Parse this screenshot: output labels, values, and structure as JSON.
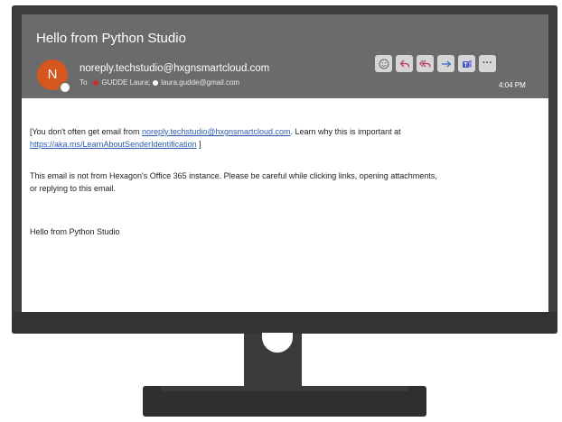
{
  "email": {
    "subject": "Hello from Python Studio",
    "avatar_initial": "N",
    "sender": "noreply.techstudio@hxgnsmartcloud.com",
    "to_label": "To",
    "recipient_1": "GUDDE Laura;",
    "recipient_2": "laura.gudde@gmail.com",
    "time": "4:04 PM",
    "toolbar": {
      "react_icon": "smiley-icon",
      "reply_icon": "reply-icon",
      "reply_all_icon": "reply-all-icon",
      "forward_icon": "forward-icon",
      "teams_icon": "teams-icon",
      "more_label": "···"
    },
    "body": {
      "line1_pre": "[You don't often get email from ",
      "line1_link": "noreply.techstudio@hxgnsmartcloud.com",
      "line1_post": ". Learn why this is important at",
      "line2_link": "https://aka.ms/LearnAboutSenderIdentification",
      "line2_post": " ]",
      "warning_1": "This email is not from Hexagon's Office 365 instance. Please be careful while clicking links, opening attachments,",
      "warning_2": "or replying to this email.",
      "closing": "Hello from Python Studio"
    }
  },
  "colors": {
    "header_bg": "#6b6b6d",
    "avatar_bg": "#d5561e",
    "link": "#2a5db0",
    "monitor": "#3d3d3f"
  }
}
